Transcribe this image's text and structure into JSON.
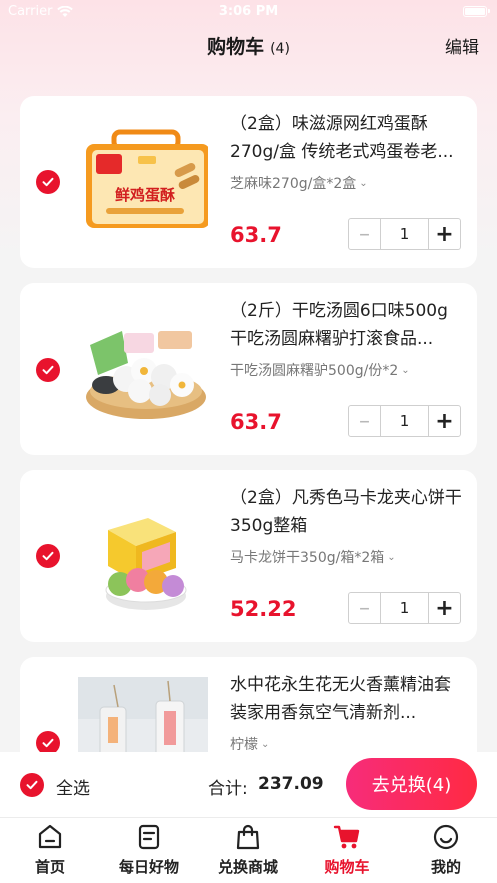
{
  "status_bar": {
    "carrier": "Carrier",
    "time": "3:06 PM"
  },
  "nav": {
    "title": "购物车",
    "count": "(4)",
    "edit_label": "编辑"
  },
  "cart_items": [
    {
      "title": "（2盒）味滋源网红鸡蛋酥270g/盒 传统老式鸡蛋卷老...",
      "spec": "芝麻味270g/盒*2盒",
      "price": "63.7",
      "qty": "1",
      "thumb_text": "鲜鸡蛋酥"
    },
    {
      "title": "（2斤）干吃汤圆6口味500g干吃汤圆麻糬驴打滚食品...",
      "spec": "干吃汤圆麻糬驴500g/份*2",
      "price": "63.7",
      "qty": "1"
    },
    {
      "title": "（2盒）凡秀色马卡龙夹心饼干350g整箱",
      "spec": "马卡龙饼干350g/箱*2箱",
      "price": "52.22",
      "qty": "1"
    },
    {
      "title": "水中花永生花无火香薰精油套装家用香氛空气清新剂...",
      "spec": "柠檬"
    }
  ],
  "summary": {
    "select_all_label": "全选",
    "total_label": "合计:",
    "total_value": "237.09",
    "exchange_label": "去兑换(4)"
  },
  "tabs": [
    {
      "label": "首页",
      "icon": "home-icon"
    },
    {
      "label": "每日好物",
      "icon": "document-icon"
    },
    {
      "label": "兑换商城",
      "icon": "shopping-bag-icon"
    },
    {
      "label": "购物车",
      "icon": "cart-icon"
    },
    {
      "label": "我的",
      "icon": "smile-icon"
    }
  ],
  "colors": {
    "accent": "#e8132d",
    "button_gradient_start": "#f72c7a",
    "button_gradient_end": "#ff2a43"
  }
}
